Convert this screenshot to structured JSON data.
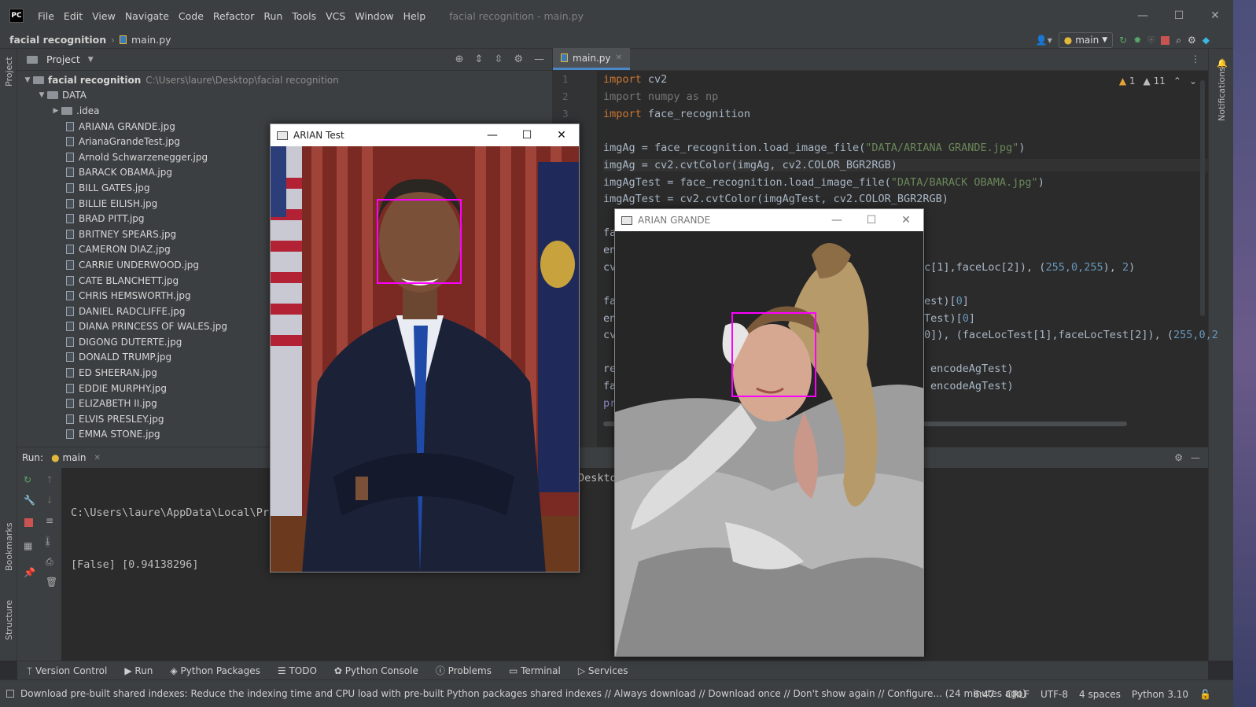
{
  "titlebar": {
    "logo": "PC",
    "menu": [
      "File",
      "Edit",
      "View",
      "Navigate",
      "Code",
      "Refactor",
      "Run",
      "Tools",
      "VCS",
      "Window",
      "Help"
    ],
    "title": "facial recognition - main.py",
    "controls": [
      "—",
      "☐",
      "✕"
    ]
  },
  "navbar": {
    "project": "facial recognition",
    "file": "main.py",
    "run_config": "main"
  },
  "left_strip": {
    "project": "Project",
    "bookmarks": "Bookmarks",
    "structure": "Structure"
  },
  "right_strip": {
    "notifications": "Notifications"
  },
  "project_panel": {
    "title": "Project",
    "root": "facial recognition",
    "root_path": "C:\\Users\\laure\\Desktop\\facial recognition",
    "data_folder": "DATA",
    "idea_folder": ".idea",
    "files": [
      "ARIANA GRANDE.jpg",
      "ArianaGrandeTest.jpg",
      "Arnold Schwarzenegger.jpg",
      "BARACK OBAMA.jpg",
      "BILL GATES.jpg",
      "BILLIE EILISH.jpg",
      "BRAD PITT.jpg",
      "BRITNEY SPEARS.jpg",
      "CAMERON DIAZ.jpg",
      "CARRIE UNDERWOOD.jpg",
      "CATE BLANCHETT.jpg",
      "CHRIS HEMSWORTH.jpg",
      "DANIEL RADCLIFFE.jpg",
      "DIANA PRINCESS OF WALES.jpg",
      "DIGONG DUTERTE.jpg",
      "DONALD TRUMP.jpg",
      "ED SHEERAN.jpg",
      "EDDIE MURPHY.jpg",
      "ELIZABETH II.jpg",
      "ELVIS PRESLEY.jpg",
      "EMMA STONE.jpg"
    ]
  },
  "editor": {
    "tab": "main.py",
    "warnings": "1",
    "weak_warnings": "11",
    "line_numbers": [
      "1",
      "2",
      "3"
    ],
    "lines": {
      "l1_kw": "import",
      "l1_rest": " cv2",
      "l2": "import numpy as np",
      "l3_kw": "import",
      "l3_rest": " face_recognition",
      "l5a": "imgAg = face_recognition.load_image_file(",
      "l5s": "\"DATA/ARIANA GRANDE.jpg\"",
      "l5b": ")",
      "l6": "imgAg = cv2.cvtColor(imgAg, cv2.COLOR_BGR2RGB)",
      "l7a": "imgAgTest = face_recognition.load_image_file(",
      "l7s": "\"DATA/BARACK OBAMA.jpg\"",
      "l7b": ")",
      "l8": "imgAgTest = cv2.cvtColor(imgAgTest, cv2.COLOR_BGR2RGB)",
      "l10": "fa",
      "l11": "en",
      "l12a": "cv",
      "l12b": "c[1],faceLoc[2]), (",
      "l12n": "255,0,255",
      "l12c": "), ",
      "l12d": "2",
      "l12e": ")",
      "l14a": "fa",
      "l14b": "est)[",
      "l14n": "0",
      "l14c": "]",
      "l15a": "en",
      "l15b": "Test)[",
      "l15n": "0",
      "l15c": "]",
      "l16a": "cv",
      "l16b": "0]), (faceLocTest[1],faceLocTest[2]), (",
      "l16n": "255,0,2",
      "l18a": "re",
      "l18b": "encodeAgTest)",
      "l19a": "fa",
      "l19b": "encodeAgTest)",
      "l20a": "pr"
    }
  },
  "run_panel": {
    "label": "Run:",
    "config": "main",
    "output_line1": "C:\\Users\\laure\\AppData\\Local\\Pro",
    "output_line1_tail": "Deskto",
    "output_line2": "[False] [0.94138296]"
  },
  "bottom_tabs": [
    "Version Control",
    "Run",
    "Python Packages",
    "TODO",
    "Python Console",
    "Problems",
    "Terminal",
    "Services"
  ],
  "status": {
    "message": "Download pre-built shared indexes: Reduce the indexing time and CPU load with pre-built Python packages shared indexes // Always download // Download once // Don't show again // Configure... (24 minutes ago)",
    "position": "6:47",
    "line_ending": "CRLF",
    "encoding": "UTF-8",
    "indent": "4 spaces",
    "interpreter": "Python 3.10"
  },
  "cv_windows": {
    "test_title": "ARIAN Test",
    "grande_title": "ARIAN GRANDE",
    "controls": [
      "—",
      "☐",
      "✕"
    ]
  },
  "colors": {
    "face_box": "#ff00ff",
    "keyword": "#cc7832",
    "string": "#6a8759",
    "number": "#6897bb"
  }
}
